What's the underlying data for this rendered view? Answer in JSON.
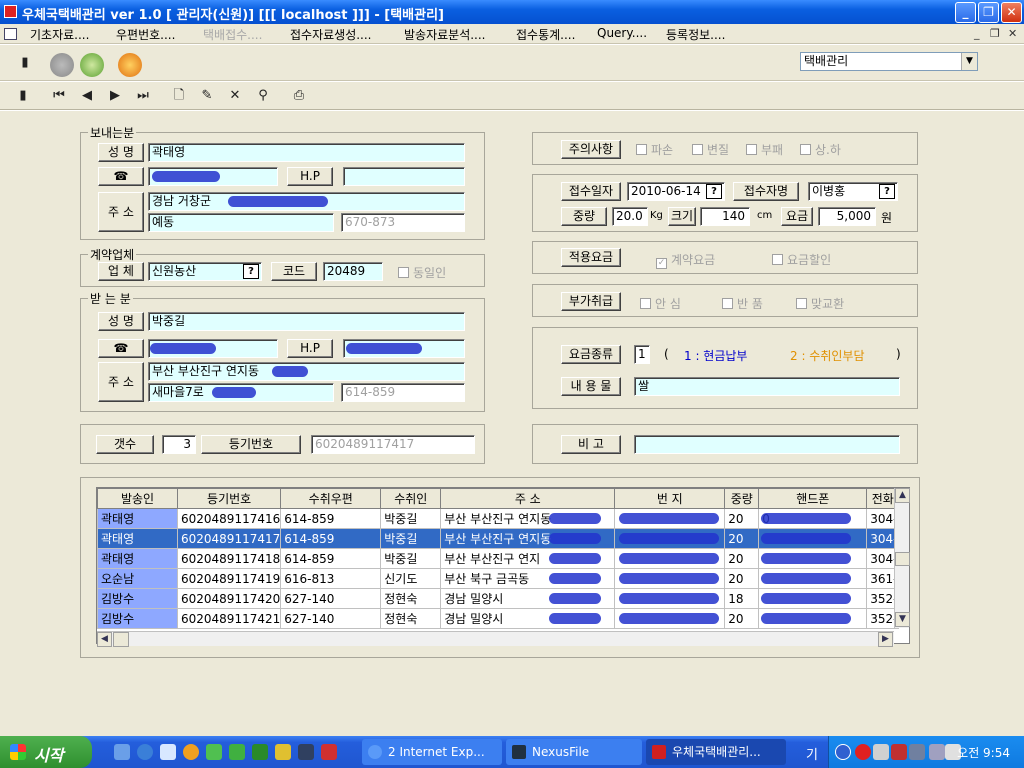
{
  "window": {
    "title": "우체국택배관리 ver 1.0 [ 관리자(신원)] [[[ localhost ]]]  - [택배관리]"
  },
  "menu": {
    "items": [
      {
        "label": "기초자료....",
        "enabled": true
      },
      {
        "label": "우편번호....",
        "enabled": true
      },
      {
        "label": "택배접수....",
        "enabled": false
      },
      {
        "label": "접수자료생성....",
        "enabled": true
      },
      {
        "label": "발송자료분석....",
        "enabled": true
      },
      {
        "label": "접수통계....",
        "enabled": true
      },
      {
        "label": "Query....",
        "enabled": true
      },
      {
        "label": "등록정보....",
        "enabled": true
      }
    ]
  },
  "toolbar": {
    "module_select": "택배관리"
  },
  "sender": {
    "group_label": "보내는분",
    "name_label": "성  명",
    "name": "곽태영",
    "phone_icon": "phone-icon",
    "hp_label": "H.P",
    "hp": "",
    "address_label": "주 소",
    "address1": "경남 거창군",
    "address2": "예동",
    "zip": "670-873"
  },
  "contract": {
    "group_label": "계약업체",
    "company_label": "업 체",
    "company": "신원농산",
    "code_label": "코드",
    "code": "20489",
    "same_label": "동일인"
  },
  "receiver": {
    "group_label": "받 는 분",
    "name_label": "성  명",
    "name": "박중길",
    "hp_label": "H.P",
    "address_label": "주 소",
    "address1": "부산 부산진구 연지동",
    "address2": "새마을7로",
    "zip": "614-859"
  },
  "count": {
    "count_label": "갯수",
    "count": "3",
    "reg_label": "등기번호",
    "reg_no": "6020489117417"
  },
  "caution": {
    "label": "주의사항",
    "options": [
      "파손",
      "변질",
      "부패",
      "상.하"
    ]
  },
  "receipt": {
    "date_label": "접수일자",
    "date": "2010-06-14",
    "receiver_label": "접수자명",
    "receiver_name": "이병홍",
    "weight_label": "중량",
    "weight": "20.0",
    "weight_unit": "Kg",
    "size_label": "크기",
    "size": "140",
    "size_unit": "cm",
    "fee_label": "요금",
    "fee": "5,000",
    "fee_unit": "원"
  },
  "applied_fee": {
    "label": "적용요금",
    "contract_fee": "계약요금",
    "discount": "요금할인"
  },
  "extra": {
    "label": "부가취급",
    "options": [
      "안 심",
      "반 품",
      "맞교환"
    ]
  },
  "fee_type": {
    "label": "요금종류",
    "value": "1",
    "open_paren": "(",
    "opt1": "1 : 현금납부",
    "opt2": "2 : 수취인부담",
    "close_paren": ")",
    "contents_label": "내 용 물",
    "contents": "쌀"
  },
  "remarks": {
    "label": "비    고",
    "value": ""
  },
  "grid": {
    "columns": [
      "발송인",
      "등기번호",
      "수취우편",
      "수취인",
      "주        소",
      "번     지",
      "중량",
      "핸드폰",
      "전화"
    ],
    "rows": [
      [
        "곽태영",
        "6020489117416",
        "614-859",
        "박중길",
        "부산 부산진구 연지동",
        "",
        "20",
        "0",
        "304-"
      ],
      [
        "곽태영",
        "6020489117417",
        "614-859",
        "박중길",
        "부산 부산진구 연지동",
        "",
        "20",
        "",
        "304-"
      ],
      [
        "곽태영",
        "6020489117418",
        "614-859",
        "박중길",
        "부산 부산진구 연지",
        "",
        "20",
        "",
        "304-"
      ],
      [
        "오순남",
        "6020489117419",
        "616-813",
        "신기도",
        "부산 북구 금곡동",
        "",
        "20",
        "",
        "361-"
      ],
      [
        "김방수",
        "6020489117420",
        "627-140",
        "정현숙",
        "경남 밀양시",
        "",
        "18",
        "",
        "352-"
      ],
      [
        "김방수",
        "6020489117421",
        "627-140",
        "정현숙",
        "경남 밀양시",
        "",
        "20",
        "",
        "352-"
      ]
    ],
    "selected_row": 1
  },
  "taskbar": {
    "start": "시작",
    "tasks": [
      "2 Internet Exp...",
      "NexusFile",
      "우체국택배관리..."
    ],
    "clock": "오전 9:54",
    "tray_label": "기"
  },
  "colors": {
    "title": "#0a5fe0",
    "field": "#e0ffff",
    "selection": "#316ac5",
    "sender_cell": "#8ea8ff",
    "fee_opt1": "#0000cc",
    "fee_opt2": "#e09000"
  }
}
